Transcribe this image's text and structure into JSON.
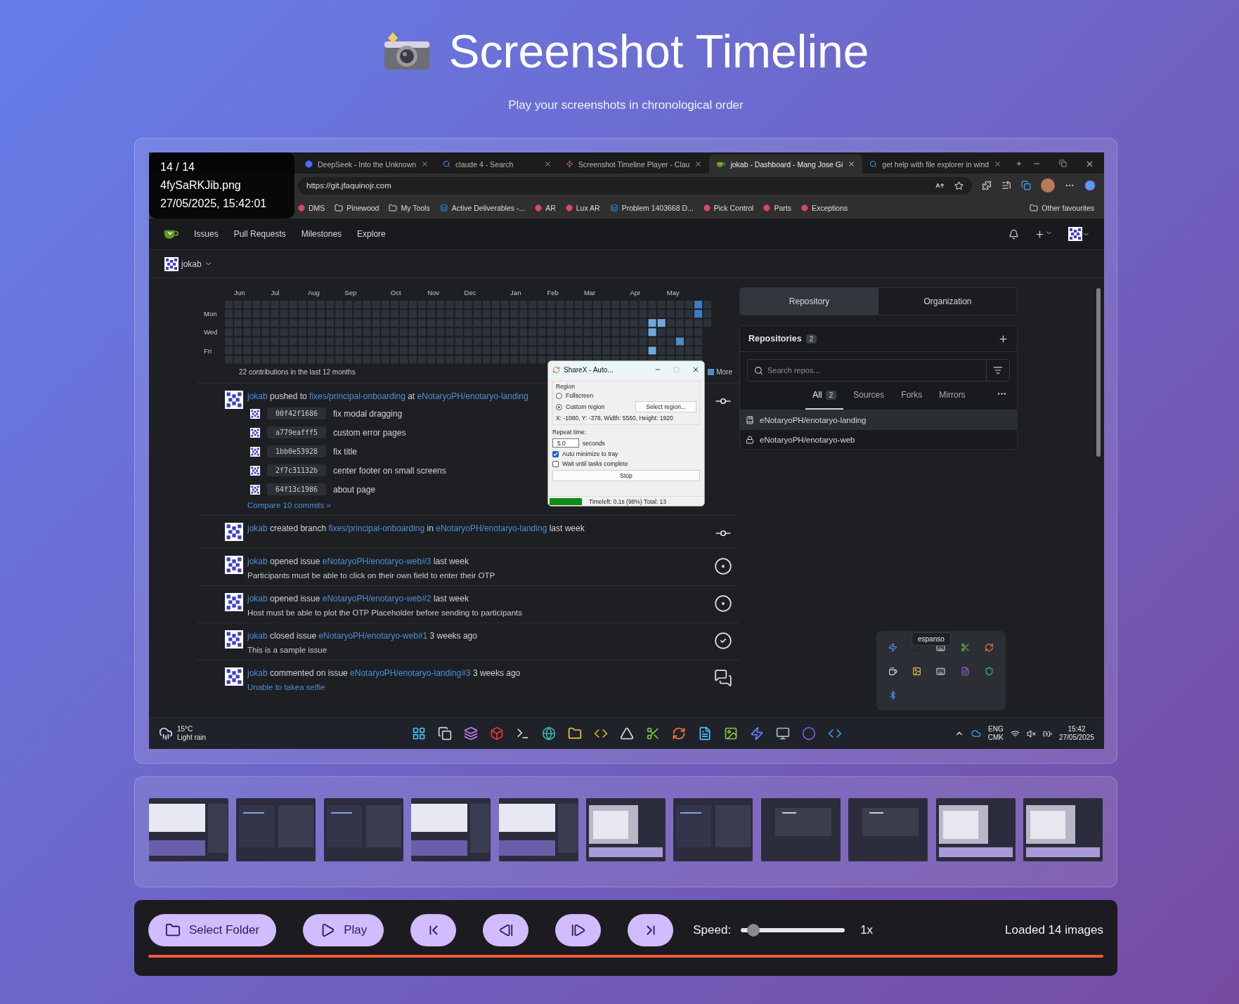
{
  "header": {
    "title": "Screenshot Timeline",
    "subtitle": "Play your screenshots in chronological order"
  },
  "viewer": {
    "info": {
      "counter": "14 / 14",
      "filename": "4fySaRKJib.png",
      "timestamp": "27/05/2025, 15:42:01"
    },
    "screenshot": {
      "browser_tabs": [
        {
          "title": "DeepSeek - Into the Unknown",
          "kind": "whale",
          "selected": false
        },
        {
          "title": "claude 4 - Search",
          "kind": "search",
          "selected": false
        },
        {
          "title": "Screenshot Timeline Player - Clau",
          "kind": "spark",
          "selected": false
        },
        {
          "title": "jokab - Dashboard - Mang Jose Gi",
          "kind": "cup",
          "selected": true
        },
        {
          "title": "get help with file explorer in wind",
          "kind": "search",
          "selected": false
        }
      ],
      "address": "https://git.jfaquinojr.com",
      "bookmarks": [
        {
          "label": "DMS",
          "kind": "site"
        },
        {
          "label": "Pinewood",
          "kind": "folder"
        },
        {
          "label": "My Tools",
          "kind": "folder"
        },
        {
          "label": "Active Deliverables -...",
          "kind": "board"
        },
        {
          "label": "AR",
          "kind": "site"
        },
        {
          "label": "Lux AR",
          "kind": "site"
        },
        {
          "label": "Problem 1403668 D...",
          "kind": "board"
        },
        {
          "label": "Pick Control",
          "kind": "site"
        },
        {
          "label": "Parts",
          "kind": "site"
        },
        {
          "label": "Exceptions",
          "kind": "site"
        }
      ],
      "other_bookmarks": "Other favourites",
      "nav": [
        "Issues",
        "Pull Requests",
        "Milestones",
        "Explore"
      ],
      "user": "jokab",
      "heatmap": {
        "months": [
          "Jun",
          "Jul",
          "Aug",
          "Sep",
          "Oct",
          "Nov",
          "Dec",
          "Jan",
          "Feb",
          "Mar",
          "Apr",
          "May"
        ],
        "days": [
          "Mon",
          "Wed",
          "Fri"
        ],
        "summary": "22 contributions in the last 12 months",
        "legend": "More"
      },
      "feed": [
        {
          "kind": "push",
          "segments": [
            {
              "text": "jokab",
              "link": true
            },
            {
              "text": "pushed to",
              "link": false
            },
            {
              "text": "fixes/principal-onboarding",
              "link": true
            },
            {
              "text": "at",
              "link": false
            },
            {
              "text": "eNotaryoPH/enotaryo-landing",
              "link": true
            }
          ],
          "commits": [
            {
              "sha": "00f42f1686",
              "message": "fix modal dragging"
            },
            {
              "sha": "a779eafff5",
              "message": "custom error pages"
            },
            {
              "sha": "1bb0e53928",
              "message": "fix title"
            },
            {
              "sha": "2f7c31132b",
              "message": "center footer on small screens"
            },
            {
              "sha": "64f13c1986",
              "message": "about page"
            }
          ],
          "compare": "Compare 10 commits »"
        },
        {
          "kind": "branch",
          "segments": [
            {
              "text": "jokab",
              "link": true
            },
            {
              "text": "created branch",
              "link": false
            },
            {
              "text": "fixes/principal-onboarding",
              "link": true
            },
            {
              "text": "in",
              "link": false
            },
            {
              "text": "eNotaryoPH/enotaryo-landing",
              "link": true
            },
            {
              "text": "last week",
              "link": false
            }
          ]
        },
        {
          "kind": "issue_open",
          "segments": [
            {
              "text": "jokab",
              "link": true
            },
            {
              "text": "opened issue",
              "link": false
            },
            {
              "text": "eNotaryoPH/enotaryo-web#3",
              "link": true
            },
            {
              "text": "last week",
              "link": false
            }
          ],
          "body": {
            "text": "Participants must be able to click on their own field to enter their OTP",
            "link": false
          }
        },
        {
          "kind": "issue_open",
          "segments": [
            {
              "text": "jokab",
              "link": true
            },
            {
              "text": "opened issue",
              "link": false
            },
            {
              "text": "eNotaryoPH/enotaryo-web#2",
              "link": true
            },
            {
              "text": "last week",
              "link": false
            }
          ],
          "body": {
            "text": "Host must be able to plot the OTP Placeholder before sending to participants",
            "link": false
          }
        },
        {
          "kind": "issue_closed",
          "segments": [
            {
              "text": "jokab",
              "link": true
            },
            {
              "text": "closed issue",
              "link": false
            },
            {
              "text": "eNotaryoPH/enotaryo-web#1",
              "link": true
            },
            {
              "text": "3 weeks ago",
              "link": false
            }
          ],
          "body": {
            "text": "This is a sample issue",
            "link": false
          }
        },
        {
          "kind": "comment",
          "segments": [
            {
              "text": "jokab",
              "link": true
            },
            {
              "text": "commented on issue",
              "link": false
            },
            {
              "text": "eNotaryoPH/enotaryo-landing#3",
              "link": true
            },
            {
              "text": "3 weeks ago",
              "link": false
            }
          ],
          "body": {
            "text": "Unable to takea selfie",
            "link": true
          }
        }
      ],
      "repo_panel": {
        "tabs": [
          {
            "label": "Repository",
            "selected": true
          },
          {
            "label": "Organization",
            "selected": false
          }
        ],
        "title": "Repositories",
        "count": "2",
        "search_placeholder": "Search repos...",
        "filters": [
          {
            "label": "All",
            "count": "2",
            "selected": true
          },
          {
            "label": "Sources",
            "selected": false
          },
          {
            "label": "Forks",
            "selected": false
          },
          {
            "label": "Mirrors",
            "selected": false
          }
        ],
        "repos": [
          {
            "name": "eNotaryoPH/enotaryo-landing",
            "kind": "public",
            "selected": true
          },
          {
            "name": "eNotaryoPH/enotaryo-web",
            "kind": "private",
            "selected": false
          }
        ]
      },
      "sharex": {
        "title": "ShareX - Auto...",
        "group": "Region",
        "regions": [
          {
            "label": "Fullscreen",
            "selected": false
          },
          {
            "label": "Custom region",
            "selected": true
          }
        ],
        "select_button": "Select region...",
        "coords": "X: -1080, Y: -378, Width: 5560, Height: 1920",
        "repeat_label": "Repeat time:",
        "repeat_value": "5.0",
        "repeat_unit": "seconds",
        "options": [
          {
            "label": "Auto minimize to tray",
            "checked": true
          },
          {
            "label": "Wait until tasks complete",
            "checked": false
          }
        ],
        "stop": "Stop",
        "progress": {
          "level": 1
        },
        "status": "Timeleft: 0.1s (98%) Total: 13"
      },
      "tray_tooltip": "espanso",
      "taskbar": {
        "temperature": "15°C",
        "weather": "Light rain",
        "language": "ENG",
        "layout": "CMK",
        "time": "15:42",
        "date": "27/05/2025"
      }
    }
  },
  "thumbnails": [
    {
      "kind": "light"
    },
    {
      "kind": "code"
    },
    {
      "kind": "code"
    },
    {
      "kind": "light"
    },
    {
      "kind": "light"
    },
    {
      "kind": "dialog"
    },
    {
      "kind": "code"
    },
    {
      "kind": "dark"
    },
    {
      "kind": "dark"
    },
    {
      "kind": "dialog"
    },
    {
      "kind": "dialog"
    }
  ],
  "controls": {
    "buttons": [
      {
        "kind": "folder",
        "label": "Select Folder"
      },
      {
        "kind": "play",
        "label": "Play"
      },
      {
        "kind": "first"
      },
      {
        "kind": "prev"
      },
      {
        "kind": "next"
      },
      {
        "kind": "last"
      }
    ],
    "speed_label": "Speed:",
    "speed": {
      "level": 0.08
    },
    "speed_value": "1x",
    "status": "Loaded 14 images",
    "progress": {
      "level": 1
    }
  }
}
